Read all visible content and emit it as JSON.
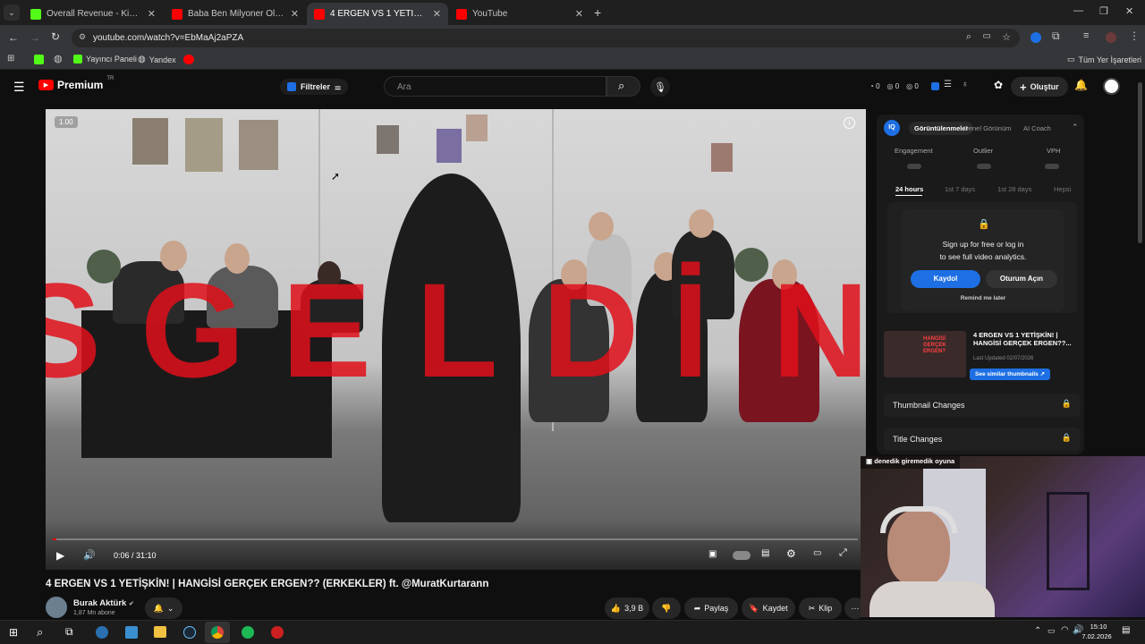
{
  "tabs": [
    {
      "label": "Overall Revenue - Kick Dashbo...",
      "favicon_color": "#53fc18"
    },
    {
      "label": "Baba Ben Milyoner Oldum #sho...",
      "favicon_color": "#ff0000"
    },
    {
      "label": "4 ERGEN VS 1 YETİŞKİN! | HANG...",
      "favicon_color": "#ff0000"
    },
    {
      "label": "YouTube",
      "favicon_color": "#ff0000"
    }
  ],
  "address": {
    "url": "youtube.com/watch?v=EbMaAj2aPZA"
  },
  "bookmarks": {
    "items": [
      "Yayıncı Paneli",
      "Yandex"
    ],
    "all": "Tüm Yer İşaretleri"
  },
  "youtube": {
    "logo": "Premium",
    "logo_sup": "TR",
    "filters": "Filtreler",
    "search_placeholder": "Ara",
    "counters": [
      "0",
      "0",
      "0"
    ],
    "create": "Oluştur"
  },
  "player": {
    "speed": "1.00",
    "time": "0:06 / 31:10",
    "overlay_letters": [
      "S",
      "G",
      "E",
      "L",
      "D",
      "İ",
      "N"
    ],
    "progress": 0.003
  },
  "video": {
    "title": "4 ERGEN VS 1 YETİŞKİN! | HANGİSİ GERÇEK ERGEN?? (ERKEKLER) ft. @MuratKurtarann",
    "channel": "Burak Aktürk",
    "subscribers": "1,87 Mn abone",
    "likes": "3,9 B",
    "share": "Paylaş",
    "save": "Kaydet",
    "clip": "Klip"
  },
  "sidebar": {
    "tabs": [
      "Görüntülenmeler",
      "Genel Görünüm",
      "AI Coach"
    ],
    "metrics": [
      "Engagement",
      "Outlier",
      "VPH"
    ],
    "periods": [
      "24 hours",
      "1st 7 days",
      "1st 28 days",
      "Hepsi"
    ],
    "signup_text_1": "Sign up for free or log in",
    "signup_text_2": "to see full video analytics.",
    "signup_button": "Kaydol",
    "login_button": "Oturum Açın",
    "remind": "Remind me later",
    "thumb_title": "4 ERGEN VS 1 YETİŞKİN! | HANGİSİ GERÇEK ERGEN??...",
    "thumb_updated": "Last Updated 02/07/2026",
    "thumb_btn": "See similar thumbnails",
    "thumb_small_text": "HANGİSİ GERÇEK ERGEN?",
    "rows": [
      "Thumbnail Changes",
      "Title Changes"
    ]
  },
  "webcam": {
    "caption": "denedik giremedik oyuna"
  },
  "taskbar": {
    "time": "15:10",
    "date": "7.02.2026"
  },
  "colors": {
    "accent_red": "#ff0000",
    "kick_green": "#53fc18",
    "vidiq_blue": "#1d6fe3",
    "overlay_red": "#e0101a"
  }
}
